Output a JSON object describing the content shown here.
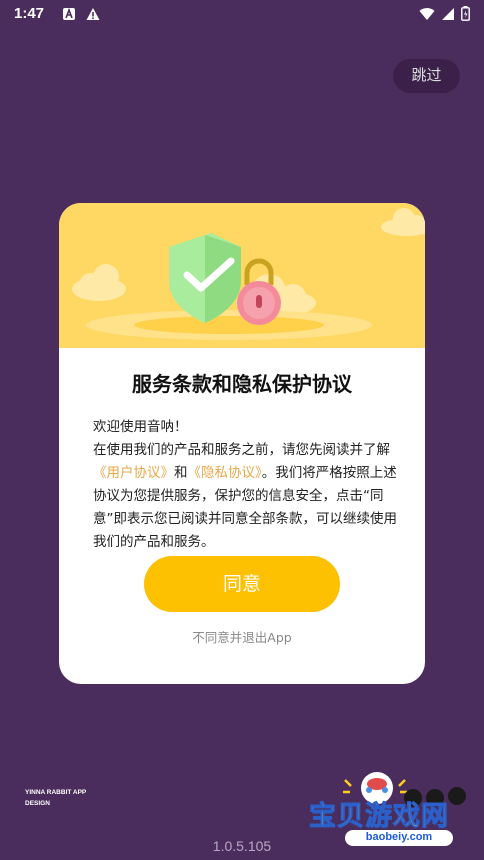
{
  "status_bar": {
    "time": "1:47"
  },
  "skip_label": "跳过",
  "dialog": {
    "title": "服务条款和隐私保护协议",
    "greeting": "欢迎使用音呐！",
    "text_1": "在使用我们的产品和服务之前，请您先阅读并了解",
    "user_agreement_link": "《用户协议》",
    "and": "和",
    "privacy_link": "《隐私协议》",
    "text_2": "。我们将严格按照上述协议为您提供服务，保护您的信息安全，点击“同意”即表示您已阅读并同意全部条款，可以继续使用我们的产品和服务。",
    "agree_label": "同意",
    "decline_label": "不同意并退出App"
  },
  "brand_line1": "YINNA RABBIT APP",
  "brand_line2": "DESIGN",
  "version": "1.0.5.105",
  "watermark": {
    "title": "宝贝游戏网",
    "url": "baobeiy.com"
  },
  "colors": {
    "background": "#4a2d5c",
    "accent": "#fdc101",
    "hero": "#ffd863",
    "link": "#e6a94a"
  }
}
